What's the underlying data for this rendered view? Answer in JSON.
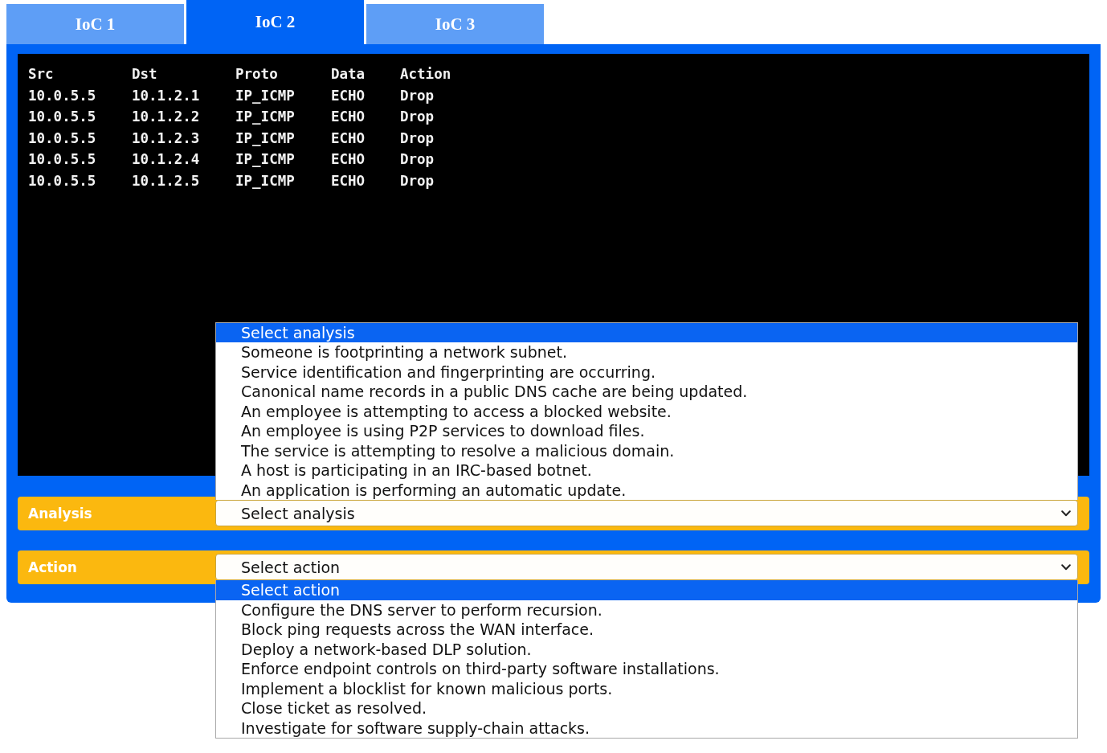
{
  "tabs": [
    {
      "label": "IoC 1",
      "selected": false
    },
    {
      "label": "IoC 2",
      "selected": true
    },
    {
      "label": "IoC 3",
      "selected": false
    }
  ],
  "log_table": {
    "columns": [
      "Src",
      "Dst",
      "Proto",
      "Data",
      "Action"
    ],
    "rows": [
      [
        "10.0.5.5",
        "10.1.2.1",
        "IP_ICMP",
        "ECHO",
        "Drop"
      ],
      [
        "10.0.5.5",
        "10.1.2.2",
        "IP_ICMP",
        "ECHO",
        "Drop"
      ],
      [
        "10.0.5.5",
        "10.1.2.3",
        "IP_ICMP",
        "ECHO",
        "Drop"
      ],
      [
        "10.0.5.5",
        "10.1.2.4",
        "IP_ICMP",
        "ECHO",
        "Drop"
      ],
      [
        "10.0.5.5",
        "10.1.2.5",
        "IP_ICMP",
        "ECHO",
        "Drop"
      ]
    ]
  },
  "fields": [
    {
      "kind": "dropup",
      "label": "Analysis",
      "value": "Select analysis",
      "expanded": true,
      "options": [
        {
          "label": "Select analysis",
          "selected": true
        },
        {
          "label": "Someone is footprinting a network subnet.",
          "selected": false
        },
        {
          "label": "Service identification and fingerprinting are occurring.",
          "selected": false
        },
        {
          "label": "Canonical name records in a public DNS cache are being updated.",
          "selected": false
        },
        {
          "label": "An employee is attempting to access a blocked website.",
          "selected": false
        },
        {
          "label": "An employee is using P2P services to download files.",
          "selected": false
        },
        {
          "label": "The service is attempting to resolve a malicious domain.",
          "selected": false
        },
        {
          "label": "A host is participating in an IRC-based botnet.",
          "selected": false
        },
        {
          "label": "An application is performing an automatic update.",
          "selected": false
        }
      ]
    },
    {
      "kind": "dropdown",
      "label": "Action",
      "value": "Select action",
      "expanded": true,
      "options": [
        {
          "label": "Select action",
          "selected": true
        },
        {
          "label": "Configure the DNS server to perform recursion.",
          "selected": false
        },
        {
          "label": "Block ping requests across the WAN interface.",
          "selected": false
        },
        {
          "label": "Deploy a network-based DLP solution.",
          "selected": false
        },
        {
          "label": "Enforce endpoint controls on third-party software installations.",
          "selected": false
        },
        {
          "label": "Implement a blocklist for known malicious ports.",
          "selected": false
        },
        {
          "label": "Close ticket as resolved.",
          "selected": false
        },
        {
          "label": "Investigate for software supply-chain attacks.",
          "selected": false
        }
      ]
    }
  ]
}
